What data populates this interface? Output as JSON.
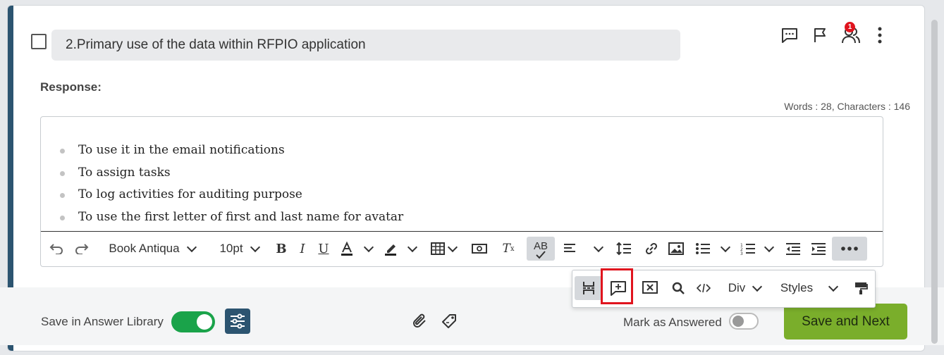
{
  "question": {
    "text": "2.Primary use of the data within RFPIO application"
  },
  "header_icons": {
    "comment": "comment-icon",
    "flag": "flag-icon",
    "assignees": "user-group-icon",
    "assignee_badge": "1",
    "more": "more-vertical-icon"
  },
  "response": {
    "label": "Response:",
    "counts": "Words : 28, Characters : 146"
  },
  "editor": {
    "bullets": [
      "To use it in the email notifications",
      "To assign tasks",
      "To log activities for auditing purpose",
      "To use the first letter of first and last name for avatar"
    ]
  },
  "toolbar": {
    "font": "Book Antiqua",
    "size": "10pt",
    "spell": "AB"
  },
  "popup": {
    "block": "Div",
    "styles": "Styles"
  },
  "footer": {
    "save_library_label": "Save in Answer Library",
    "save_library_on": true,
    "mark_answered_label": "Mark as Answered",
    "mark_answered_on": false,
    "save_next_label": "Save and Next"
  },
  "colors": {
    "accent": "#2c5470",
    "toggle_on": "#1aa34a",
    "primary_button": "#7aae2b",
    "badge": "#e0141e",
    "highlight": "#e0141e"
  }
}
